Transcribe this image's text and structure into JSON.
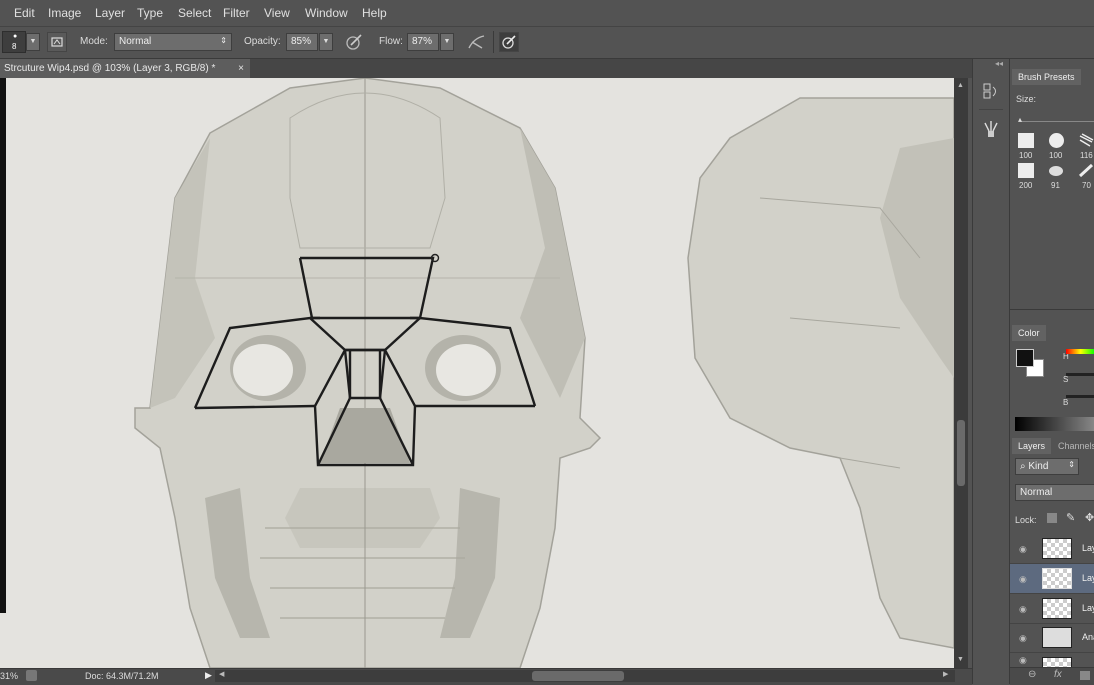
{
  "menu": [
    "Edit",
    "Image",
    "Layer",
    "Type",
    "Select",
    "Filter",
    "View",
    "Window",
    "Help"
  ],
  "options": {
    "brush_size": "8",
    "mode_label": "Mode:",
    "mode_value": "Normal",
    "opacity_label": "Opacity:",
    "opacity_value": "85%",
    "flow_label": "Flow:",
    "flow_value": "87%"
  },
  "document_tab": {
    "title": "Strcuture Wip4.psd @ 103% (Layer 3, RGB/8) *",
    "close": "×"
  },
  "status": {
    "zoom": "31%",
    "doc": "Doc: 64.3M/71.2M"
  },
  "brush_presets": {
    "tab": "Brush Presets",
    "size_label": "Size:",
    "presets": [
      {
        "size": "100"
      },
      {
        "size": "100"
      },
      {
        "size": "116"
      },
      {
        "size": "200"
      },
      {
        "size": "91"
      },
      {
        "size": "70"
      }
    ]
  },
  "color_panel": {
    "tab": "Color",
    "h": "H",
    "s": "S",
    "b": "B",
    "foreground": "#111111",
    "background": "#ffffff"
  },
  "layers_panel": {
    "tabs": [
      "Layers",
      "Channels"
    ],
    "kind": "Kind",
    "blend": "Normal",
    "lock_label": "Lock:",
    "layers": [
      {
        "name": "Lay"
      },
      {
        "name": "Lay"
      },
      {
        "name": "Lay"
      },
      {
        "name": "Ana"
      },
      {
        "name": ""
      }
    ]
  },
  "colors": {
    "ui_bg": "#535353",
    "canvas": "#e4e3df",
    "selected_layer": "#5d6a7f"
  }
}
